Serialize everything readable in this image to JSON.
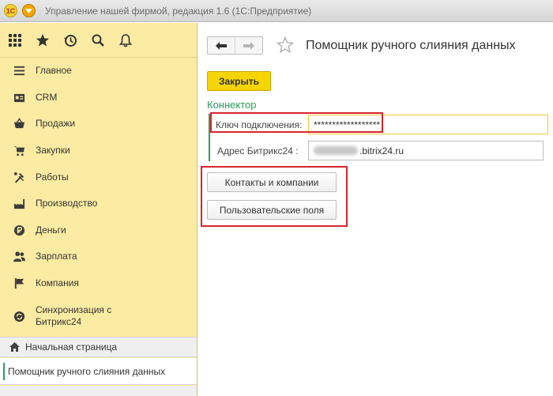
{
  "window": {
    "title": "Управление нашей фирмой, редакция 1.6  (1С:Предприятие)",
    "logo_text": "1С"
  },
  "toolbar": {
    "icons": [
      "apps-grid-icon",
      "star-icon",
      "history-icon",
      "search-icon",
      "bell-icon"
    ]
  },
  "sidebar": {
    "items": [
      {
        "label": "Главное",
        "icon": "menu-lines-icon"
      },
      {
        "label": "CRM",
        "icon": "crm-card-icon"
      },
      {
        "label": "Продажи",
        "icon": "basket-icon"
      },
      {
        "label": "Закупки",
        "icon": "cart-icon"
      },
      {
        "label": "Работы",
        "icon": "tools-icon"
      },
      {
        "label": "Производство",
        "icon": "factory-icon"
      },
      {
        "label": "Деньги",
        "icon": "coin-icon"
      },
      {
        "label": "Зарплата",
        "icon": "people-icon"
      },
      {
        "label": "Компания",
        "icon": "flag-icon"
      },
      {
        "label": "Синхронизация с Битрикс24",
        "icon": "sync-icon"
      }
    ],
    "home_label": "Начальная страница",
    "open_window_label": "Помощник ручного слияния данных"
  },
  "form": {
    "title": "Помощник ручного слияния данных",
    "close_label": "Закрыть",
    "group_title": "Коннектор",
    "key_label": "Ключ подключения:",
    "key_value": "******************",
    "bitrix_label": "Адрес Битрикс24 :",
    "bitrix_value": ".bitrix24.ru",
    "contacts_button": "Контакты и компании",
    "custom_fields_button": "Пользовательские поля"
  },
  "colors": {
    "sidebar_bg": "#fbeba3",
    "accent_yellow": "#f5d400",
    "group_green": "#2a9b5a",
    "highlight_red": "#d6252c"
  }
}
